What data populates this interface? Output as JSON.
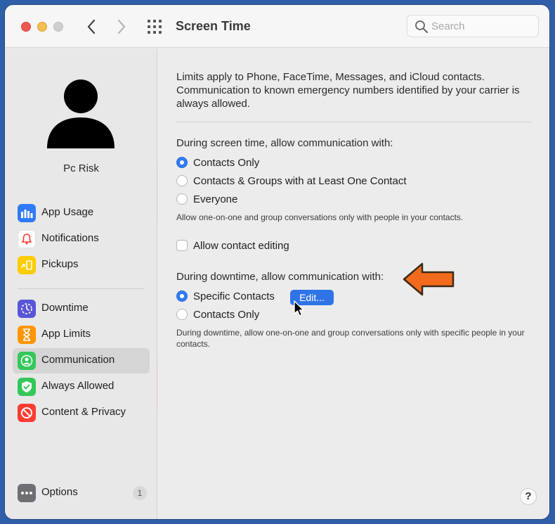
{
  "window": {
    "title": "Screen Time",
    "search_placeholder": "Search"
  },
  "user": {
    "name": "Pc Risk"
  },
  "sidebar": {
    "items": [
      {
        "label": "App Usage",
        "icon": "chart-icon",
        "color": "#2f7bf5"
      },
      {
        "label": "Notifications",
        "icon": "bell-icon",
        "color": "#ff3b30"
      },
      {
        "label": "Pickups",
        "icon": "pickups-icon",
        "color": "#ffcc00"
      },
      {
        "label": "Downtime",
        "icon": "moon-clock-icon",
        "color": "#5856d6"
      },
      {
        "label": "App Limits",
        "icon": "hourglass-icon",
        "color": "#ff9500"
      },
      {
        "label": "Communication",
        "icon": "person-circle-icon",
        "color": "#34c759"
      },
      {
        "label": "Always Allowed",
        "icon": "checkmark-shield-icon",
        "color": "#34c759"
      },
      {
        "label": "Content & Privacy",
        "icon": "no-entry-icon",
        "color": "#ff3b30"
      }
    ],
    "selected": "Communication",
    "options": {
      "label": "Options",
      "badge": "1",
      "icon": "ellipsis-icon"
    }
  },
  "main": {
    "intro": "Limits apply to Phone, FaceTime, Messages, and iCloud contacts. Communication to known emergency numbers identified by your carrier is always allowed.",
    "screen_time": {
      "heading": "During screen time, allow communication with:",
      "options": [
        "Contacts Only",
        "Contacts & Groups with at Least One Contact",
        "Everyone"
      ],
      "selected": "Contacts Only",
      "note": "Allow one-on-one and group conversations only with people in your contacts."
    },
    "allow_contact_editing": {
      "label": "Allow contact editing",
      "checked": false
    },
    "downtime": {
      "heading": "During downtime, allow communication with:",
      "options": [
        "Specific Contacts",
        "Contacts Only"
      ],
      "selected": "Specific Contacts",
      "edit_label": "Edit...",
      "note": "During downtime, allow one-on-one and group conversations only with specific people in your contacts."
    },
    "help_label": "?"
  },
  "colors": {
    "accent": "#2f7bf5",
    "callout_arrow": "#f26a1b"
  }
}
